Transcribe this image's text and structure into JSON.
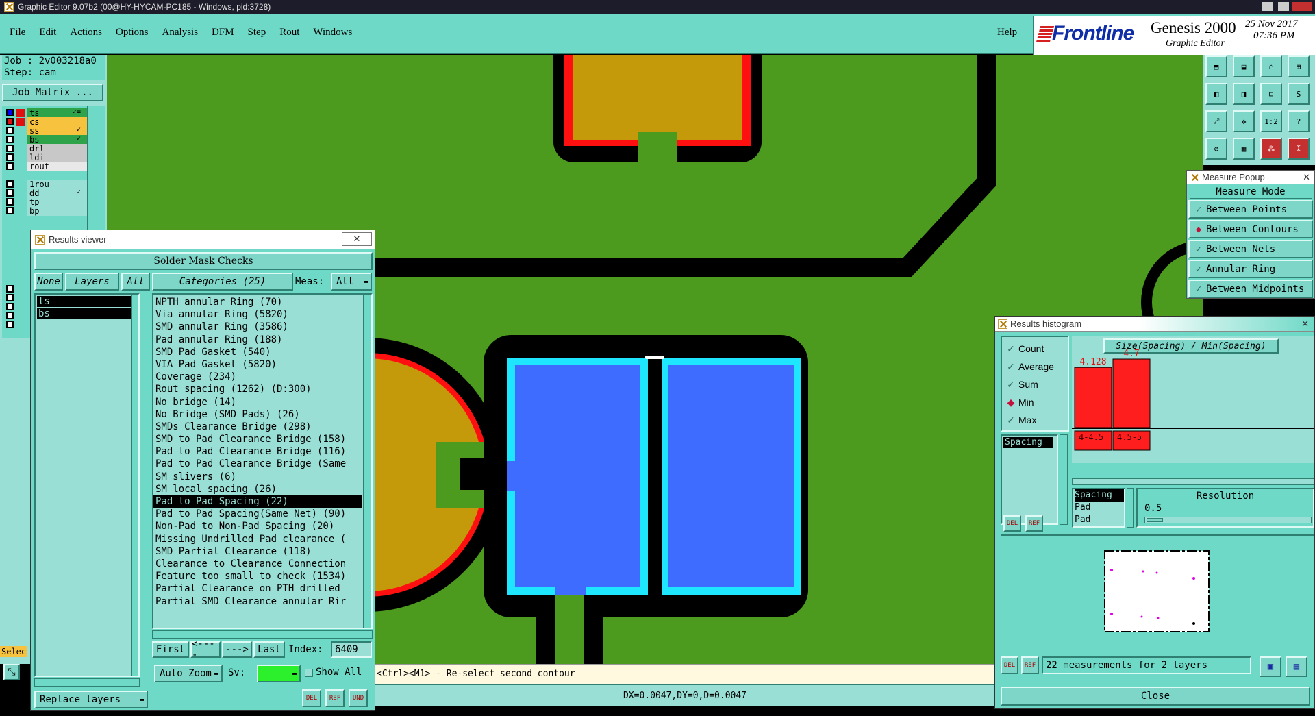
{
  "window": {
    "title": "Graphic Editor 9.07b2 (00@HY-HYCAM-PC185 - Windows, pid:3728)"
  },
  "menu": {
    "items": [
      "File",
      "Edit",
      "Actions",
      "Options",
      "Analysis",
      "DFM",
      "Step",
      "Rout",
      "Windows"
    ],
    "help": "Help"
  },
  "brand": {
    "logo": "Frontline",
    "product": "Genesis 2000",
    "subtitle": "Graphic Editor",
    "date": "25 Nov 2017",
    "time": "07:36 PM"
  },
  "job": {
    "job_label": "Job : 2v003218a0",
    "step_label": "Step: cam",
    "matrix_button": "Job Matrix ..."
  },
  "layers": [
    {
      "name": "ts",
      "color": "#2fa34a",
      "mark": "✓≡",
      "box": "#0000ff"
    },
    {
      "name": "cs",
      "color": "#f7c33f",
      "mark": "",
      "box": "#e01010"
    },
    {
      "name": "ss",
      "color": "#f7c33f",
      "mark": "✓",
      "box": ""
    },
    {
      "name": "bs",
      "color": "#2fa34a",
      "mark": "✓",
      "box": ""
    },
    {
      "name": "drl",
      "color": "#c8c8c8",
      "mark": "",
      "box": ""
    },
    {
      "name": "ldi",
      "color": "#c8c8c8",
      "mark": "",
      "box": ""
    },
    {
      "name": "rout",
      "color": "#e8e8e8",
      "mark": "",
      "box": ""
    },
    {
      "name": "1rou",
      "color": "#9adfd5",
      "mark": "",
      "box": ""
    },
    {
      "name": "dd",
      "color": "#9adfd5",
      "mark": "✓",
      "box": ""
    },
    {
      "name": "tp",
      "color": "#9adfd5",
      "mark": "",
      "box": ""
    },
    {
      "name": "bp",
      "color": "#9adfd5",
      "mark": "",
      "box": ""
    }
  ],
  "sel_label": "Selec",
  "results_viewer": {
    "title": "Results viewer",
    "header": "Solder Mask Checks",
    "none_btn": "None",
    "layers_btn": "Layers",
    "all_btn": "All",
    "categories_btn": "Categories (25)",
    "meas_label": "Meas:",
    "meas_value": "All",
    "layer_list": [
      "ts",
      "bs"
    ],
    "categories": [
      "NPTH annular Ring (70)",
      "Via annular Ring (5820)",
      "SMD annular Ring (3586)",
      "Pad annular Ring (188)",
      "SMD Pad Gasket (540)",
      "VIA Pad Gasket (5820)",
      "Coverage (234)",
      "Rout spacing (1262)        (D:300)",
      "No bridge (14)",
      "No Bridge (SMD Pads) (26)",
      "SMDs Clearance Bridge (298)",
      "SMD to Pad Clearance Bridge (158)",
      "Pad to Pad Clearance Bridge (116)",
      "Pad to Pad Clearance Bridge (Same",
      "SM slivers (6)",
      "SM local spacing (26)",
      "Pad to Pad Spacing (22)",
      "Pad to Pad Spacing(Same Net) (90)",
      "Non-Pad to Non-Pad Spacing (20)",
      "Missing Undrilled Pad clearance (",
      "SMD Partial Clearance (118)",
      "Clearance to Clearance Connection",
      "Feature too small to check (1534)",
      "Partial Clearance on PTH drilled",
      "Partial SMD Clearance annular Rir"
    ],
    "selected_index": 16,
    "nav": {
      "first": "First",
      "prev": "<----",
      "next": "--->",
      "last": "Last",
      "index_label": "Index:",
      "index_value": "6409"
    },
    "auto_zoom": "Auto Zoom",
    "sv_label": "Sv:",
    "show_all": "Show All",
    "replace_layers": "Replace layers",
    "del": "DEL",
    "ref": "REF",
    "und": "UND"
  },
  "measure_popup": {
    "title": "Measure Popup",
    "header": "Measure Mode",
    "options": [
      "Between Points",
      "Between Contours",
      "Between Nets",
      "Annular Ring",
      "Between Midpoints"
    ],
    "selected": 1
  },
  "histogram": {
    "title": "Results histogram",
    "options": [
      "Count",
      "Average",
      "Sum",
      "Min",
      "Max"
    ],
    "selected": 3,
    "chart_title": "Size(Spacing) / Min(Spacing)",
    "bars": [
      {
        "label": "4.128",
        "bin": "4-4.5",
        "value": 4.128
      },
      {
        "label": "4.7",
        "bin": "4.5-5",
        "value": 4.7
      }
    ],
    "attr_list": [
      "Spacing"
    ],
    "sel_list": [
      "Spacing",
      "Pad",
      "Pad"
    ],
    "resolution_label": "Resolution",
    "resolution_value": "0.5",
    "footer": "22 measurements for 2 layers",
    "close": "Close"
  },
  "status": {
    "prompt": "<Ctrl><M1> - Re-select second contour",
    "coords": "DX=0.0047,DY=0,D=0.0047"
  },
  "colors": {
    "board": "#4c9b1f",
    "mask": "#000000",
    "copper": "#c49a0a",
    "pad_blue": "#3d6cff",
    "cyan": "#1ee6ff",
    "red": "#ff1010",
    "ui_teal": "#6fd9c7"
  }
}
